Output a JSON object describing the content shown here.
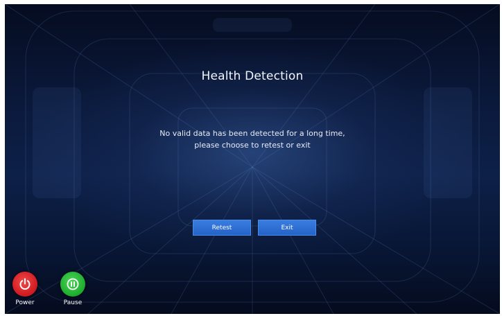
{
  "dialog": {
    "title": "Health Detection",
    "message_line1": "No valid data has been detected for a long time,",
    "message_line2": "please choose to retest or exit",
    "retest_label": "Retest",
    "exit_label": "Exit"
  },
  "controls": {
    "power_label": "Power",
    "pause_label": "Pause"
  },
  "colors": {
    "background": "#0b1a3d",
    "button": "#2f6fd6",
    "power": "#d41f24",
    "pause": "#22b232"
  }
}
